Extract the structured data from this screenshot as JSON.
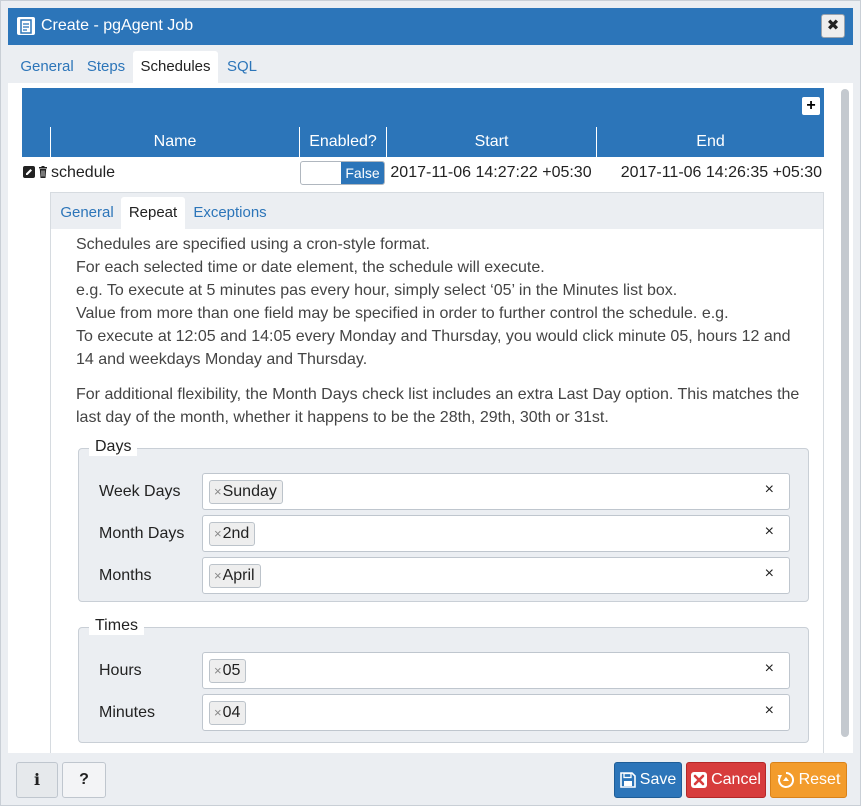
{
  "window": {
    "title": "Create - pgAgent Job",
    "close_glyph": "✖"
  },
  "tabs": [
    "General",
    "Steps",
    "Schedules",
    "SQL"
  ],
  "active_tab": "Schedules",
  "grid": {
    "add_glyph": "+",
    "columns": [
      "Name",
      "Enabled?",
      "Start",
      "End"
    ],
    "rows": [
      {
        "name": "schedule",
        "enabled": "False",
        "start": "2017-11-06 14:27:22 +05:30",
        "end": "2017-11-06 14:26:35 +05:30"
      }
    ]
  },
  "subtabs": [
    "General",
    "Repeat",
    "Exceptions"
  ],
  "active_subtab": "Repeat",
  "help_paragraphs": [
    "Schedules are specified using a cron-style format.",
    "For each selected time or date element, the schedule will execute.",
    "e.g. To execute at 5 minutes pas every hour, simply select ‘05’ in the Minutes list box.",
    "Value from more than one field may be specified in order to further control the schedule. e.g.",
    "To execute at 12:05 and 14:05 every Monday and Thursday, you would click minute 05, hours 12 and 14 and weekdays Monday and Thursday.",
    "For additional flexibility, the Month Days check list includes an extra Last Day option. This matches the last day of the month, whether it happens to be the 28th, 29th, 30th or 31st."
  ],
  "days": {
    "legend": "Days",
    "week_days": {
      "label": "Week Days",
      "chip": "Sunday"
    },
    "month_days": {
      "label": "Month Days",
      "chip": "2nd"
    },
    "months": {
      "label": "Months",
      "chip": "April"
    }
  },
  "times": {
    "legend": "Times",
    "hours": {
      "label": "Hours",
      "chip": "05"
    },
    "minutes": {
      "label": "Minutes",
      "chip": "04"
    }
  },
  "chip_remove_glyph": "×",
  "clear_glyph": "×",
  "footer": {
    "info_label": "i",
    "help_label": "?",
    "save_label": "Save",
    "cancel_label": "Cancel",
    "reset_label": "Reset"
  },
  "colors": {
    "primary": "#2c75b9",
    "danger": "#d73c3c",
    "warning": "#f39c2c"
  },
  "icons": [
    "job-icon",
    "close-icon",
    "add-icon",
    "edit-icon",
    "delete-icon",
    "save-icon",
    "cancel-icon",
    "reset-icon"
  ]
}
